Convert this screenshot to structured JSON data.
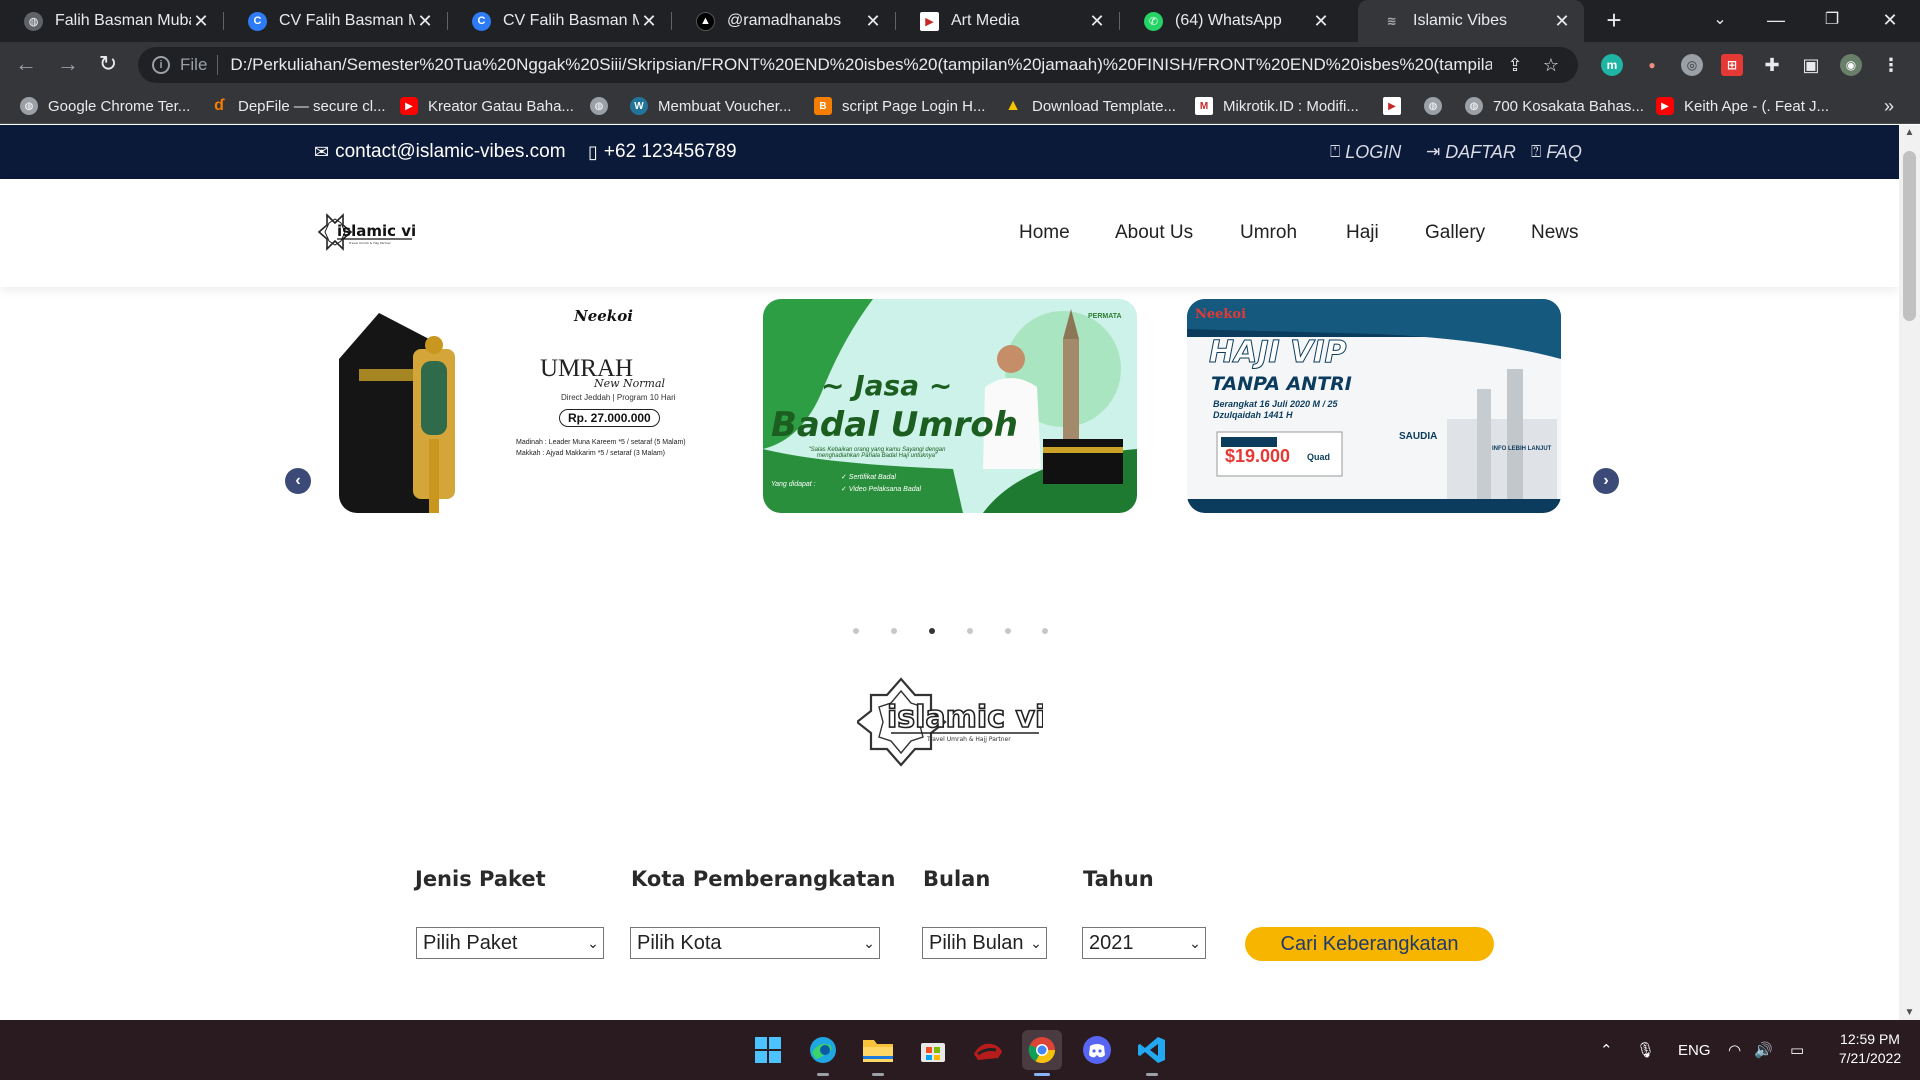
{
  "browser": {
    "tabs": [
      {
        "title": "Falih Basman Mubarok",
        "icon": "globe-icon",
        "color": "#5f6368"
      },
      {
        "title": "CV Falih Basman Mubarok",
        "icon": "canva-icon",
        "color": "#2e7bf6"
      },
      {
        "title": "CV Falih Basman Mubarok",
        "icon": "canva-icon",
        "color": "#2e7bf6"
      },
      {
        "title": "@ramadhanabs",
        "icon": "triangle-logo-icon",
        "color": "#000000"
      },
      {
        "title": "Art Media",
        "icon": "artmedia-icon",
        "color": "#ffffff"
      },
      {
        "title": "(64) WhatsApp",
        "icon": "whatsapp-icon",
        "color": "#25d366"
      },
      {
        "title": "Islamic Vibes",
        "icon": "islamic-vibes-icon",
        "color": "#888888"
      }
    ],
    "active_tab": 6,
    "address": {
      "scheme": "File",
      "url": "D:/Perkuliahan/Semester%20Tua%20Nggak%20Siii/Skripsian/FRONT%20END%20isbes%20(tampilan%20jamaah)%20FINISH/FRONT%20END%20isbes%20(tampilan..."
    },
    "bookmarks": [
      {
        "label": "Google Chrome Ter...",
        "icon": "globe-icon",
        "color": "#9aa0a6"
      },
      {
        "label": "DepFile — secure cl...",
        "icon": "depfile-icon",
        "color": "#f57c00"
      },
      {
        "label": "Kreator Gatau Baha...",
        "icon": "youtube-icon",
        "color": "#ff0000"
      },
      {
        "label": "",
        "icon": "globe-icon",
        "color": "#9aa0a6"
      },
      {
        "label": "Membuat Voucher...",
        "icon": "wordpress-icon",
        "color": "#21759b"
      },
      {
        "label": "script Page Login H...",
        "icon": "blogger-icon",
        "color": "#f57d00"
      },
      {
        "label": "Download Template...",
        "icon": "linux-icon",
        "color": "#f5c400"
      },
      {
        "label": "Mikrotik.ID : Modifi...",
        "icon": "mikrotik-icon",
        "color": "#c62828"
      },
      {
        "label": "",
        "icon": "artmedia-icon",
        "color": "#ffffff"
      },
      {
        "label": "",
        "icon": "globe-icon",
        "color": "#9aa0a6"
      },
      {
        "label": "700 Kosakata Bahas...",
        "icon": "globe-icon",
        "color": "#9aa0a6"
      },
      {
        "label": "Keith Ape - (. Feat J...",
        "icon": "youtube-icon",
        "color": "#ff0000"
      }
    ],
    "more_bookmarks": "»"
  },
  "site": {
    "topbar": {
      "email": "contact@islamic-vibes.com",
      "phone": "+62 123456789",
      "login": "LOGIN",
      "register": "DAFTAR",
      "faq": "FAQ"
    },
    "nav": [
      "Home",
      "About Us",
      "Umroh",
      "Haji",
      "Gallery",
      "News"
    ],
    "slides": {
      "umrah": {
        "brand": "Neekoi",
        "title": "UMRAH",
        "subtitle": "New Normal",
        "desc": "Direct Jeddah | Program 10 Hari",
        "price": "Rp. 27.000.000",
        "madinah": "Madinah : Leader Muna Kareem *5 / setaraf (5 Malam)",
        "makkah": "Makkah : Ajyad Makkarim *5 / setaraf (3 Malam)"
      },
      "badal": {
        "title1": "~ Jasa ~",
        "title2": "Badal Umroh",
        "tagline": "\"Salas Kebaikan orang yang kamu Sayangi dengan menghadiahkan Pahala Badal Haji untuknya\"",
        "get_label": "Yang didapat :",
        "item1": "✓ Sertifikat Badal",
        "item2": "✓ Video Pelaksana Badal",
        "brand": "PERMATA"
      },
      "haji": {
        "brand": "Neekoi",
        "title1": "HAJI VIP",
        "title2": "TANPA ANTRI",
        "dates": "Berangkat 16 Juli 2020 M / 25 Dzulqaidah 1441 H",
        "price": "$19.000",
        "price_unit": "Quad",
        "airline": "SAUDIA",
        "info": "INFO LEBIH LANJUT"
      }
    },
    "carousel_dots": 6,
    "active_dot": 2,
    "search": {
      "labels": {
        "package": "Jenis Paket",
        "city": "Kota Pemberangkatan",
        "month": "Bulan",
        "year": "Tahun"
      },
      "values": {
        "package": "Pilih Paket",
        "city": "Pilih Kota",
        "month": "Pilih Bulan",
        "year": "2021"
      },
      "button": "Cari Keberangkatan"
    },
    "logo_text": "islamic vibes"
  },
  "taskbar": {
    "apps": [
      "windows-start-icon",
      "edge-icon",
      "file-explorer-icon",
      "microsoft-store-icon",
      "game-icon",
      "chrome-icon",
      "discord-icon",
      "vscode-icon"
    ],
    "active_app": 5,
    "language": "ENG",
    "time": "12:59 PM",
    "date": "7/21/2022"
  },
  "colors": {
    "topbar_bg": "#0c1a3a",
    "accent_yellow": "#f7b500",
    "button_text": "#1e3a6e",
    "chrome_dark": "#202124"
  }
}
